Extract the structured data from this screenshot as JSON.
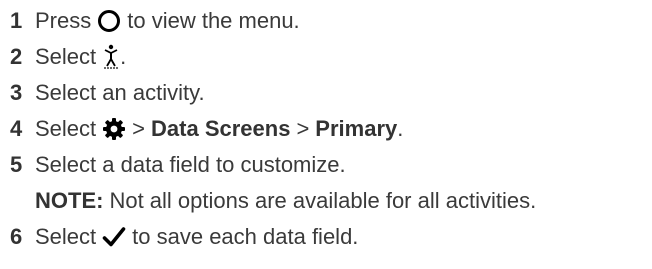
{
  "steps": [
    {
      "num": "1",
      "pre": "Press",
      "post": "to view the menu.",
      "icon": "circle-button-icon"
    },
    {
      "num": "2",
      "pre": "Select",
      "post": ".",
      "icon": "activity-person-icon"
    },
    {
      "num": "3",
      "text": "Select an activity."
    },
    {
      "num": "4",
      "pre": "Select",
      "sep1": ">",
      "bold1": "Data Screens",
      "sep2": ">",
      "bold2": "Primary",
      "post": ".",
      "icon": "gear-icon"
    },
    {
      "num": "5",
      "text": "Select a data field to customize."
    },
    {
      "num": "6",
      "pre": "Select",
      "post": "to save each data field.",
      "icon": "checkmark-icon"
    }
  ],
  "note": {
    "label": "NOTE:",
    "text": "Not all options are available for all activities."
  }
}
